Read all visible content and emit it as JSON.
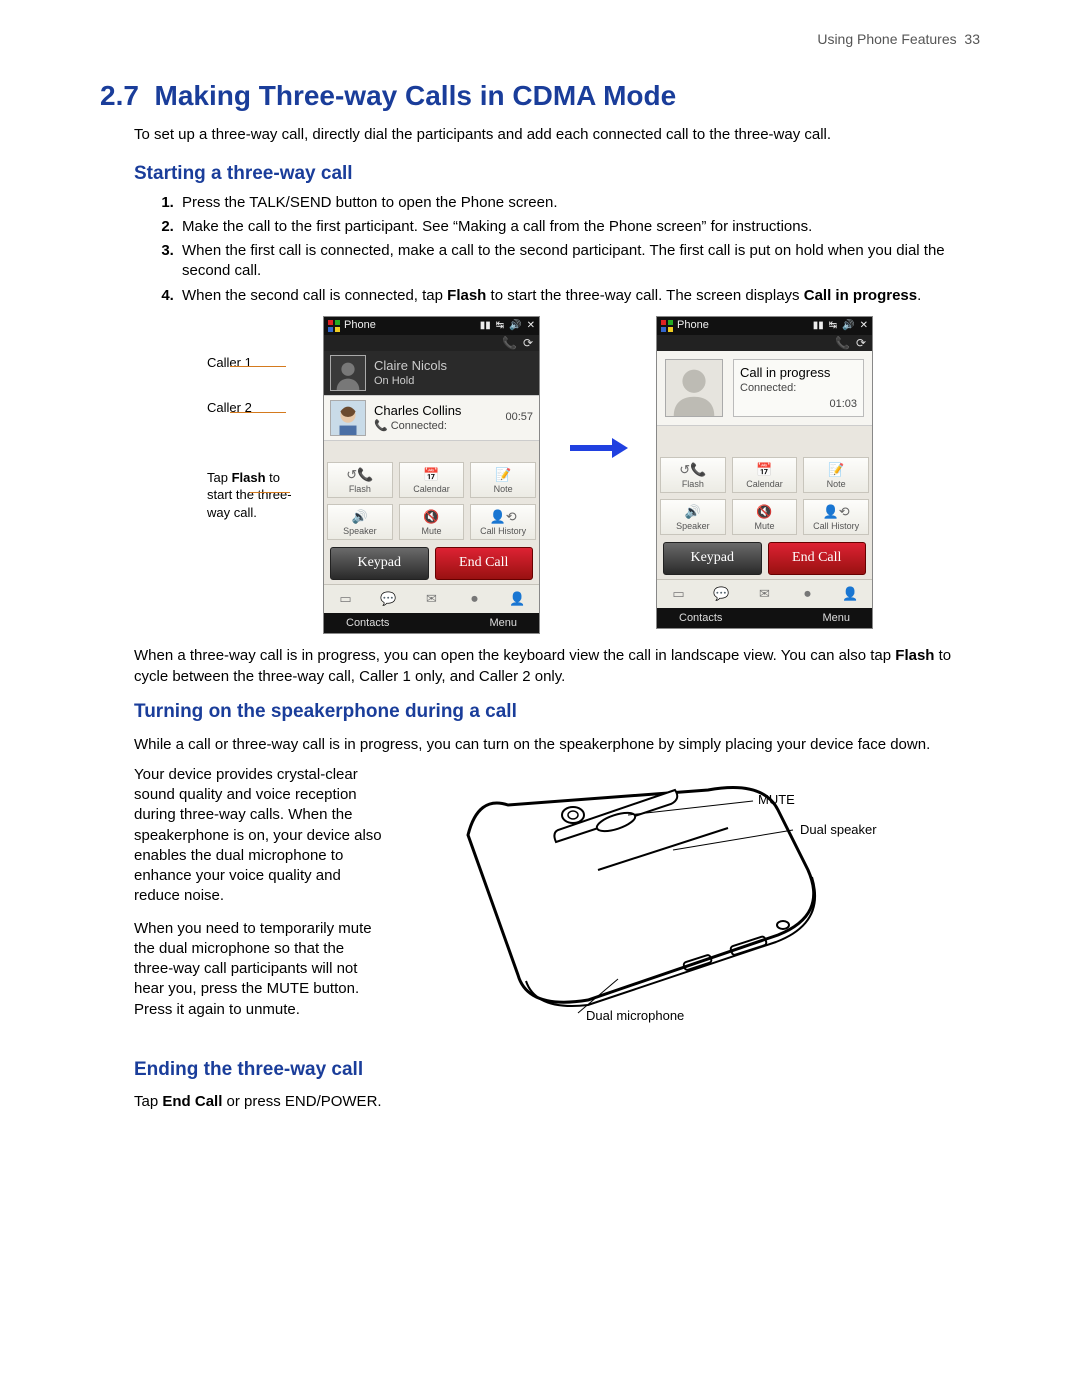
{
  "header": {
    "running": "Using Phone Features",
    "page_no": "33"
  },
  "title": {
    "num": "2.7",
    "text": "Making Three-way Calls in CDMA Mode"
  },
  "intro": "To set up a three-way call, directly dial the participants and add each connected call to the three-way call.",
  "sub1": "Starting a three-way call",
  "steps": {
    "s1": "Press the TALK/SEND button to open the Phone screen.",
    "s2": "Make the call to the first participant. See “Making a call from the Phone screen” for instructions.",
    "s3": "When the first call is connected, make a call to the second participant. The first call is put on hold when you dial the second call.",
    "s4a": "When the second call is connected, tap ",
    "s4b": "Flash",
    "s4c": " to start the three-way call. The screen displays ",
    "s4d": "Call in progress",
    "s4e": "."
  },
  "annots": {
    "a1": "Caller 1",
    "a2": "Caller 2",
    "a3a": "Tap ",
    "a3b": "Flash",
    "a3c": " to start the three-way call."
  },
  "phone": {
    "title": "Phone",
    "c1_name": "Claire Nicols",
    "c1_stat": "On Hold",
    "c2_name": "Charles Collins",
    "c2_stat": "Connected:",
    "c2_time": "00:57",
    "prog_title": "Call in progress",
    "prog_stat": "Connected:",
    "prog_time": "01:03",
    "btns": {
      "flash": "Flash",
      "calendar": "Calendar",
      "note": "Note",
      "speaker": "Speaker",
      "mute": "Mute",
      "history": "Call History"
    },
    "keypad": "Keypad",
    "endcall": "End Call",
    "sk_left": "Contacts",
    "sk_right": "Menu"
  },
  "after_fig_a": "When a three-way call is in progress, you can open the keyboard view the call in landscape view. You can also tap ",
  "after_fig_b": "Flash",
  "after_fig_c": " to cycle between the three-way call, Caller 1 only, and Caller 2 only.",
  "sub2": "Turning on the speakerphone during a call",
  "spk_intro": "While a call or three-way call is in progress, you can turn on the speakerphone by simply placing your device face down.",
  "spk_p1": "Your device provides crystal-clear sound quality and voice reception during three-way calls. When the speakerphone is on, your device also enables the dual microphone to enhance your voice quality and reduce noise.",
  "spk_p2": "When you need to temporarily mute the dual microphone so that the three-way call participants will not hear you, press the MUTE button. Press it again to unmute.",
  "dlabels": {
    "mute": "MUTE",
    "dualspk": "Dual speaker",
    "dualmic": "Dual microphone"
  },
  "sub3": "Ending the three-way call",
  "end_a": "Tap ",
  "end_b": "End Call",
  "end_c": " or press END/POWER."
}
